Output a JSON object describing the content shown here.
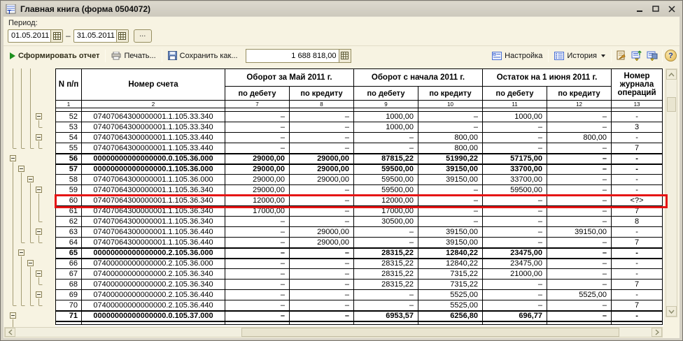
{
  "window": {
    "title": "Главная книга (форма 0504072)",
    "controls": {
      "minimize": "_",
      "maximize": "□",
      "close": "×"
    }
  },
  "period": {
    "label": "Период:",
    "from": "01.05.2011",
    "dash": "–",
    "to": "31.05.2011",
    "more": "..."
  },
  "toolbar": {
    "generate": "Сформировать отчет",
    "print": "Печать...",
    "save_as": "Сохранить как...",
    "amount": "1 688 818,00",
    "settings": "Настройка",
    "history": "История",
    "help": "?"
  },
  "icons": {
    "history-arrow": "▾",
    "scroll-up": "∧",
    "scroll-down": "∨",
    "scroll-left": "<",
    "scroll-right": ">"
  },
  "colors": {
    "highlight_red": "#e51414",
    "panel_cream": "#f7f3e2",
    "window_gray": "#d5d1c5",
    "tree_line": "#a49c74",
    "green_play": "#1d8f1d"
  },
  "table": {
    "headers": {
      "n": "N п/п",
      "account": "Номер счета",
      "may": "Оборот за Май 2011 г.",
      "ytd": "Оборот с начала 2011 г.",
      "balance": "Остаток на 1 июня 2011 г.",
      "journal": "Номер журнала операций",
      "debit": "по дебету",
      "credit": "по кредиту",
      "col_numbers": [
        "1",
        "2",
        "7",
        "8",
        "9",
        "10",
        "11",
        "12",
        "13"
      ]
    },
    "rows": [
      {
        "n": "52",
        "acc": "07407064300000001.1.105.33.340",
        "c7": "–",
        "c8": "–",
        "c9": "1000,00",
        "c10": "–",
        "c11": "1000,00",
        "c12": "–",
        "j": "-",
        "lvl": 4,
        "bold": false,
        "thick": false,
        "hl": false
      },
      {
        "n": "53",
        "acc": "07407064300000001.1.105.33.340",
        "c7": "–",
        "c8": "–",
        "c9": "1000,00",
        "c10": "–",
        "c11": "–",
        "c12": "–",
        "j": "3",
        "lvl": 0,
        "bold": false,
        "thick": false,
        "hl": false
      },
      {
        "n": "54",
        "acc": "07407064300000001.1.105.33.440",
        "c7": "–",
        "c8": "–",
        "c9": "–",
        "c10": "800,00",
        "c11": "–",
        "c12": "800,00",
        "j": "-",
        "lvl": 4,
        "bold": false,
        "thick": false,
        "hl": false
      },
      {
        "n": "55",
        "acc": "07407064300000001.1.105.33.440",
        "c7": "–",
        "c8": "–",
        "c9": "–",
        "c10": "800,00",
        "c11": "–",
        "c12": "–",
        "j": "7",
        "lvl": 0,
        "bold": false,
        "thick": false,
        "hl": false
      },
      {
        "n": "56",
        "acc": "00000000000000000.0.105.36.000",
        "c7": "29000,00",
        "c8": "29000,00",
        "c9": "87815,22",
        "c10": "51990,22",
        "c11": "57175,00",
        "c12": "–",
        "j": "-",
        "lvl": 1,
        "bold": true,
        "thick": true,
        "hl": false
      },
      {
        "n": "57",
        "acc": "00000000000000000.1.105.36.000",
        "c7": "29000,00",
        "c8": "29000,00",
        "c9": "59500,00",
        "c10": "39150,00",
        "c11": "33700,00",
        "c12": "–",
        "j": "-",
        "lvl": 2,
        "bold": true,
        "thick": false,
        "hl": false
      },
      {
        "n": "58",
        "acc": "07407064300000001.1.105.36.000",
        "c7": "29000,00",
        "c8": "29000,00",
        "c9": "59500,00",
        "c10": "39150,00",
        "c11": "33700,00",
        "c12": "–",
        "j": "-",
        "lvl": 3,
        "bold": false,
        "thick": false,
        "hl": false
      },
      {
        "n": "59",
        "acc": "07407064300000001.1.105.36.340",
        "c7": "29000,00",
        "c8": "–",
        "c9": "59500,00",
        "c10": "–",
        "c11": "59500,00",
        "c12": "–",
        "j": "-",
        "lvl": 4,
        "bold": false,
        "thick": false,
        "hl": false
      },
      {
        "n": "60",
        "acc": "07407064300000001.1.105.36.340",
        "c7": "12000,00",
        "c8": "–",
        "c9": "12000,00",
        "c10": "–",
        "c11": "–",
        "c12": "–",
        "j": "<?>",
        "lvl": 0,
        "bold": false,
        "thick": false,
        "hl": true
      },
      {
        "n": "61",
        "acc": "07407064300000001.1.105.36.340",
        "c7": "17000,00",
        "c8": "–",
        "c9": "17000,00",
        "c10": "–",
        "c11": "–",
        "c12": "–",
        "j": "7",
        "lvl": 0,
        "bold": false,
        "thick": false,
        "hl": false
      },
      {
        "n": "62",
        "acc": "07407064300000001.1.105.36.340",
        "c7": "–",
        "c8": "–",
        "c9": "30500,00",
        "c10": "–",
        "c11": "–",
        "c12": "–",
        "j": "8",
        "lvl": 0,
        "bold": false,
        "thick": false,
        "hl": false
      },
      {
        "n": "63",
        "acc": "07407064300000001.1.105.36.440",
        "c7": "–",
        "c8": "29000,00",
        "c9": "–",
        "c10": "39150,00",
        "c11": "–",
        "c12": "39150,00",
        "j": "-",
        "lvl": 4,
        "bold": false,
        "thick": false,
        "hl": false
      },
      {
        "n": "64",
        "acc": "07407064300000001.1.105.36.440",
        "c7": "–",
        "c8": "29000,00",
        "c9": "–",
        "c10": "39150,00",
        "c11": "–",
        "c12": "–",
        "j": "7",
        "lvl": 0,
        "bold": false,
        "thick": false,
        "hl": false
      },
      {
        "n": "65",
        "acc": "00000000000000000.2.105.36.000",
        "c7": "–",
        "c8": "–",
        "c9": "28315,22",
        "c10": "12840,22",
        "c11": "23475,00",
        "c12": "–",
        "j": "-",
        "lvl": 2,
        "bold": true,
        "thick": true,
        "hl": false
      },
      {
        "n": "66",
        "acc": "07400000000000000.2.105.36.000",
        "c7": "–",
        "c8": "–",
        "c9": "28315,22",
        "c10": "12840,22",
        "c11": "23475,00",
        "c12": "–",
        "j": "-",
        "lvl": 3,
        "bold": false,
        "thick": false,
        "hl": false
      },
      {
        "n": "67",
        "acc": "07400000000000000.2.105.36.340",
        "c7": "–",
        "c8": "–",
        "c9": "28315,22",
        "c10": "7315,22",
        "c11": "21000,00",
        "c12": "–",
        "j": "-",
        "lvl": 4,
        "bold": false,
        "thick": false,
        "hl": false
      },
      {
        "n": "68",
        "acc": "07400000000000000.2.105.36.340",
        "c7": "–",
        "c8": "–",
        "c9": "28315,22",
        "c10": "7315,22",
        "c11": "–",
        "c12": "–",
        "j": "7",
        "lvl": 0,
        "bold": false,
        "thick": false,
        "hl": false
      },
      {
        "n": "69",
        "acc": "07400000000000000.2.105.36.440",
        "c7": "–",
        "c8": "–",
        "c9": "–",
        "c10": "5525,00",
        "c11": "–",
        "c12": "5525,00",
        "j": "-",
        "lvl": 4,
        "bold": false,
        "thick": false,
        "hl": false
      },
      {
        "n": "70",
        "acc": "07400000000000000.2.105.36.440",
        "c7": "–",
        "c8": "–",
        "c9": "–",
        "c10": "5525,00",
        "c11": "–",
        "c12": "–",
        "j": "7",
        "lvl": 0,
        "bold": false,
        "thick": false,
        "hl": false
      },
      {
        "n": "71",
        "acc": "00000000000000000.0.105.37.000",
        "c7": "–",
        "c8": "–",
        "c9": "6953,57",
        "c10": "6256,80",
        "c11": "696,77",
        "c12": "–",
        "j": "-",
        "lvl": 1,
        "bold": true,
        "thick": true,
        "hl": false
      }
    ]
  }
}
